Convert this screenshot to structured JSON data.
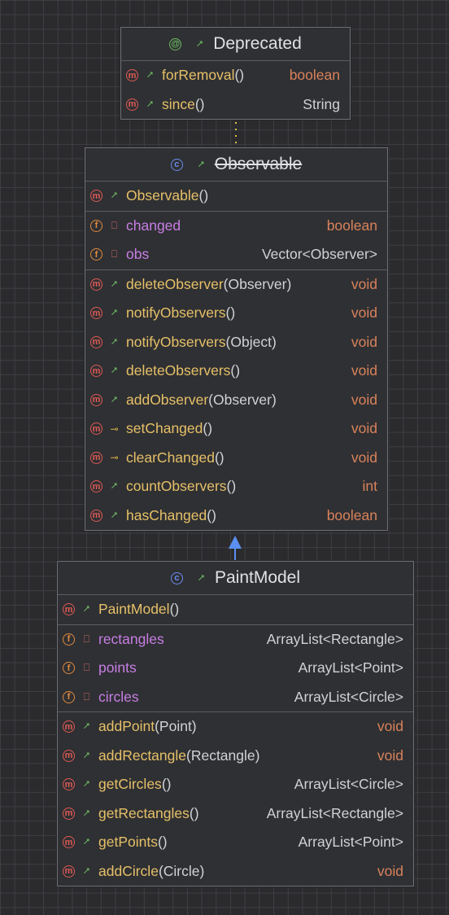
{
  "annotation": {
    "name": "Deprecated",
    "badge": "@",
    "visibility": "public",
    "sections": [
      [
        {
          "badge": "m",
          "visibility": "public",
          "name": "forRemoval",
          "params": "()",
          "type": "boolean",
          "type_kind": "primitive"
        },
        {
          "badge": "m",
          "visibility": "public",
          "name": "since",
          "params": "()",
          "type": "String",
          "type_kind": "reference"
        }
      ]
    ]
  },
  "observable": {
    "name": "Observable",
    "badge": "c",
    "visibility": "public",
    "deprecated": true,
    "sections": [
      [
        {
          "badge": "m",
          "visibility": "public",
          "name": "Observable",
          "params": "()",
          "type": "",
          "type_kind": "reference"
        }
      ],
      [
        {
          "badge": "f",
          "visibility": "private",
          "name": "changed",
          "params": "",
          "type": "boolean",
          "type_kind": "primitive",
          "kind": "field"
        },
        {
          "badge": "f",
          "visibility": "private",
          "name": "obs",
          "params": "",
          "type": "Vector<Observer>",
          "type_kind": "reference",
          "kind": "field"
        }
      ],
      [
        {
          "badge": "m",
          "visibility": "public",
          "name": "deleteObserver",
          "params": "(Observer)",
          "type": "void",
          "type_kind": "primitive"
        },
        {
          "badge": "m",
          "visibility": "public",
          "name": "notifyObservers",
          "params": "()",
          "type": "void",
          "type_kind": "primitive"
        },
        {
          "badge": "m",
          "visibility": "public",
          "name": "notifyObservers",
          "params": "(Object)",
          "type": "void",
          "type_kind": "primitive"
        },
        {
          "badge": "m",
          "visibility": "public",
          "name": "deleteObservers",
          "params": "()",
          "type": "void",
          "type_kind": "primitive"
        },
        {
          "badge": "m",
          "visibility": "public",
          "name": "addObserver",
          "params": "(Observer)",
          "type": "void",
          "type_kind": "primitive"
        },
        {
          "badge": "m",
          "visibility": "protected",
          "name": "setChanged",
          "params": "()",
          "type": "void",
          "type_kind": "primitive"
        },
        {
          "badge": "m",
          "visibility": "protected",
          "name": "clearChanged",
          "params": "()",
          "type": "void",
          "type_kind": "primitive"
        },
        {
          "badge": "m",
          "visibility": "public",
          "name": "countObservers",
          "params": "()",
          "type": "int",
          "type_kind": "primitive"
        },
        {
          "badge": "m",
          "visibility": "public",
          "name": "hasChanged",
          "params": "()",
          "type": "boolean",
          "type_kind": "primitive"
        }
      ]
    ]
  },
  "paintmodel": {
    "name": "PaintModel",
    "badge": "c",
    "visibility": "public",
    "sections": [
      [
        {
          "badge": "m",
          "visibility": "public",
          "name": "PaintModel",
          "params": "()",
          "type": "",
          "type_kind": "reference"
        }
      ],
      [
        {
          "badge": "f",
          "visibility": "private",
          "name": "rectangles",
          "params": "",
          "type": "ArrayList<Rectangle>",
          "type_kind": "reference",
          "kind": "field"
        },
        {
          "badge": "f",
          "visibility": "private",
          "name": "points",
          "params": "",
          "type": "ArrayList<Point>",
          "type_kind": "reference",
          "kind": "field"
        },
        {
          "badge": "f",
          "visibility": "private",
          "name": "circles",
          "params": "",
          "type": "ArrayList<Circle>",
          "type_kind": "reference",
          "kind": "field"
        }
      ],
      [
        {
          "badge": "m",
          "visibility": "public",
          "name": "addPoint",
          "params": "(Point)",
          "type": "void",
          "type_kind": "primitive"
        },
        {
          "badge": "m",
          "visibility": "public",
          "name": "addRectangle",
          "params": "(Rectangle)",
          "type": "void",
          "type_kind": "primitive"
        },
        {
          "badge": "m",
          "visibility": "public",
          "name": "getCircles",
          "params": "()",
          "type": "ArrayList<Circle>",
          "type_kind": "reference"
        },
        {
          "badge": "m",
          "visibility": "public",
          "name": "getRectangles",
          "params": "()",
          "type": "ArrayList<Rectangle>",
          "type_kind": "reference"
        },
        {
          "badge": "m",
          "visibility": "public",
          "name": "getPoints",
          "params": "()",
          "type": "ArrayList<Point>",
          "type_kind": "reference"
        },
        {
          "badge": "m",
          "visibility": "public",
          "name": "addCircle",
          "params": "(Circle)",
          "type": "void",
          "type_kind": "primitive"
        }
      ]
    ]
  },
  "connectors": {
    "annotation_link_color": "#d9c14a",
    "inheritance_color": "#5b8ff0"
  }
}
